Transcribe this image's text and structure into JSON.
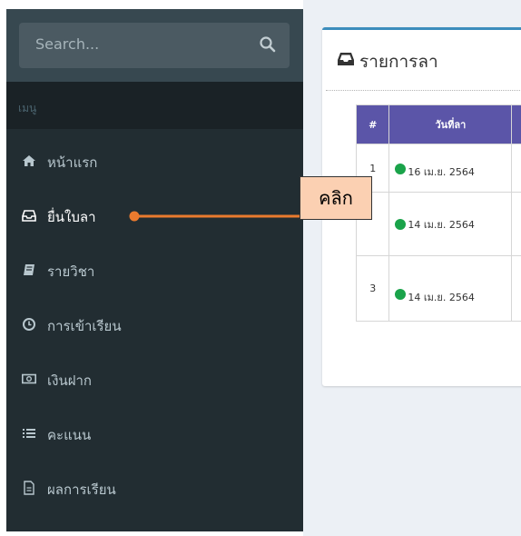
{
  "sidebar": {
    "search_placeholder": "Search...",
    "menu_header": "เมนู",
    "items": [
      {
        "label": "หน้าแรก",
        "icon": "home-icon"
      },
      {
        "label": "ยื่นใบลา",
        "icon": "inbox-icon"
      },
      {
        "label": "รายวิชา",
        "icon": "book-icon"
      },
      {
        "label": "การเข้าเรียน",
        "icon": "clock-icon"
      },
      {
        "label": "เงินฝาก",
        "icon": "money-icon"
      },
      {
        "label": "คะแนน",
        "icon": "list-icon"
      },
      {
        "label": "ผลการเรียน",
        "icon": "file-icon"
      }
    ]
  },
  "box": {
    "title": "รายการลา",
    "table": {
      "headers": [
        "#",
        "วันที่ลา"
      ],
      "rows": [
        {
          "num": "1",
          "date": "16 เม.ย. 2564"
        },
        {
          "num": "",
          "date": "14 เม.ย. 2564"
        },
        {
          "num": "3",
          "date": "14 เม.ย. 2564"
        }
      ]
    }
  },
  "annotation": {
    "callout_text": "คลิก"
  },
  "colors": {
    "sidebar_bg": "#222d32",
    "table_header": "#5b55a8",
    "status_dot": "#1aa34a",
    "callout_fill": "#fbd0b2",
    "connector": "#ea7a2e",
    "box_border": "#3c8dbc"
  }
}
